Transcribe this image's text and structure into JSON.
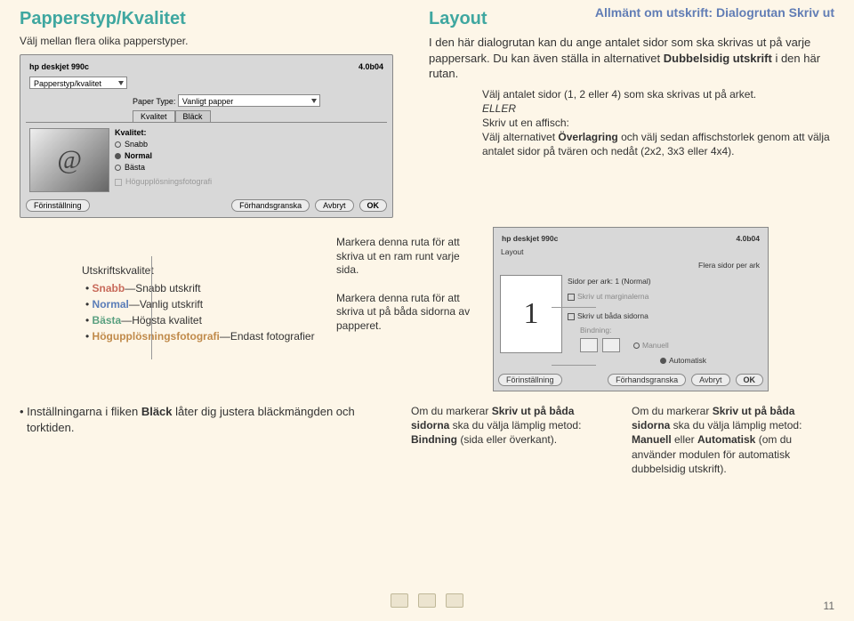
{
  "header": {
    "section": "Allmänt om utskrift: Dialogrutan Skriv ut"
  },
  "left": {
    "title": "Papperstyp/Kvalitet",
    "sub": "Välj mellan flera olika papperstyper.",
    "dlg": {
      "printer": "hp deskjet 990c",
      "version": "4.0b04",
      "panel": "Papperstyp/kvalitet",
      "paper_label": "Paper Type:",
      "paper_value": "Vanligt papper",
      "tab1": "Kvalitet",
      "tab2": "Bläck",
      "thumb": "@",
      "qual_label": "Kvalitet:",
      "q1": "Snabb",
      "q2": "Normal",
      "q3": "Bästa",
      "highres": "Högupplösningsfotografi",
      "btn_preset": "Förinställning",
      "btn_preview": "Förhandsgranska",
      "btn_cancel": "Avbryt",
      "btn_ok": "OK"
    }
  },
  "right": {
    "title": "Layout",
    "p1a": "I den här dialogrutan kan du ange antalet sidor som ska skrivas ut på varje pappersark. Du kan även ställa in alternativet ",
    "p1b_bold": "Dubbelsidig utskrift",
    "p1c": " i den här rutan.",
    "l1": "Välj antalet sidor (1, 2 eller 4) som ska skrivas ut på arket.",
    "eller": "ELLER",
    "l2": "Skriv ut en affisch:",
    "l3a": "Välj alternativet ",
    "l3b_bold": "Överlagring",
    "l3c": " och välj sedan affischstorlek genom att välja antalet sidor på tvären och nedåt (2x2, 3x3 eller 4x4)."
  },
  "qual": {
    "hdr": "Utskriftskvalitet",
    "i1_label": "Snabb",
    "i1_desc": "—Snabb utskrift",
    "i2_label": "Normal",
    "i2_desc": "—Vanlig utskrift",
    "i3_label": "Bästa",
    "i3_desc": "—Högsta kvalitet",
    "i4_label": "Högupplösningsfotografi",
    "i4_desc": "—Endast fotografier"
  },
  "callout": {
    "c1": "Markera denna ruta för att skriva ut en ram runt varje sida.",
    "c2": "Markera denna ruta för att skriva ut på båda sidorna av papperet."
  },
  "dlg2": {
    "printer": "hp deskjet 990c",
    "version": "4.0b04",
    "panel": "Layout",
    "combo1_label": "Flera sidor per ark",
    "pages_label": "Sidor per ark:",
    "pages_val": "1 (Normal)",
    "margins": "Skriv ut marginalerna",
    "both": "Skriv ut båda sidorna",
    "binding": "Bindning:",
    "manual": "Manuell",
    "auto": "Automatisk",
    "preview_num": "1",
    "btn_preset": "Förinställning",
    "btn_preview": "Förhandsgranska",
    "btn_cancel": "Avbryt",
    "btn_ok": "OK"
  },
  "bottom": {
    "note_a": "Inställningarna i fliken ",
    "note_b_bold": "Bläck",
    "note_c": " låter dig justera bläckmängden och torktiden.",
    "e1a": "Om du markerar ",
    "e1b_bold": "Skriv ut på båda sidorna",
    "e1c": " ska du välja lämplig metod: ",
    "e1d_bold": "Bindning",
    "e1e": " (sida eller överkant).",
    "e2a": "Om du markerar ",
    "e2b_bold": "Skriv ut på båda sidorna",
    "e2c": " ska du välja lämplig metod: ",
    "e2d_bold": "Manuell",
    "e2e": " eller ",
    "e2f_bold": "Automatisk",
    "e2g": " (om du använder modulen för automatisk dubbelsidig utskrift)."
  },
  "pagenum": "11"
}
